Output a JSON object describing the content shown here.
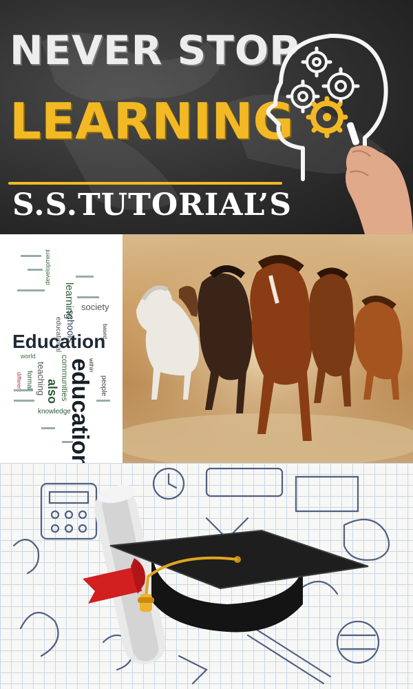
{
  "banner": {
    "line1": "NEVER STOP",
    "line2": "LEARNING",
    "brand": "S.S.TUTORIAL’S",
    "colors": {
      "chalk": "#ededed",
      "accent": "#f2b925",
      "board": "#2e2e2e"
    },
    "icons": [
      "head-gears-icon",
      "hand-chalk-icon"
    ]
  },
  "wordcloud": {
    "education_cap": "Education",
    "education_big": "education",
    "society": "society",
    "learning": "learning",
    "schools": "schools",
    "communities": "communities",
    "also": "also",
    "knowledge": "knowledge",
    "teaching": "teaching",
    "people": "people",
    "educational": "educational",
    "world": "world",
    "formal": "formal",
    "different": "different",
    "based": "based",
    "within": "within",
    "development": "development"
  },
  "icons": {
    "horses": "running-horses-painting",
    "graduation": "graduation-cap-icon",
    "diploma": "diploma-scroll-icon",
    "doodles": "school-doodle-icons"
  }
}
